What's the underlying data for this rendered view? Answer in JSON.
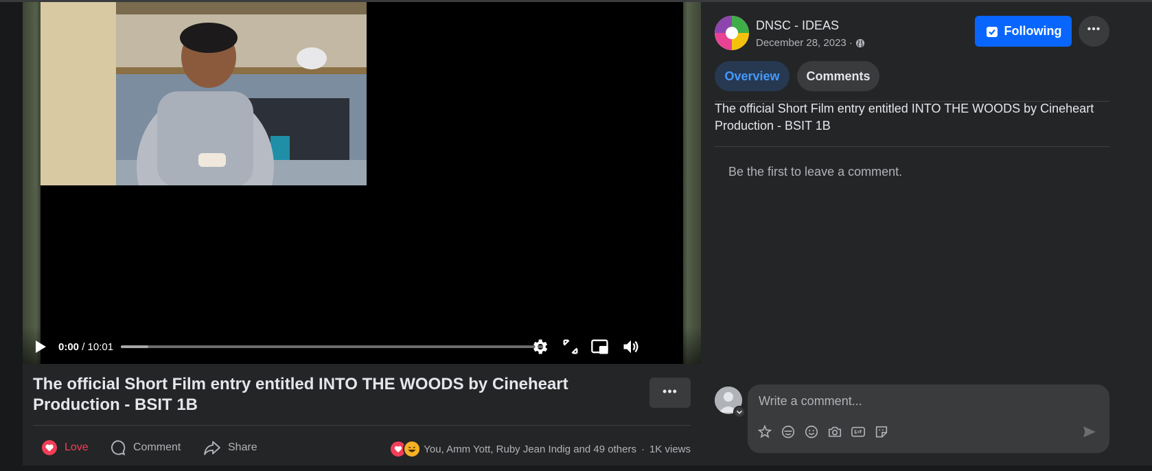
{
  "video": {
    "time_current": "0:00",
    "time_separator": " / ",
    "time_total": "10:01",
    "progress_fraction": 0.065,
    "icons": [
      "play-icon",
      "settings-icon",
      "fullscreen-icon",
      "picture-in-picture-icon",
      "volume-icon"
    ]
  },
  "post": {
    "title": "The official Short Film entry entitled INTO THE WOODS by Cineheart Production - BSIT 1B",
    "more_label": "•••",
    "actions": {
      "love": "Love",
      "comment": "Comment",
      "share": "Share"
    },
    "reactions_text": "You, Amm Yott, Ruby Jean Indig and 49 others",
    "separator": "·",
    "views": "1K views"
  },
  "sidebar": {
    "page_name": "DNSC - IDEAS",
    "date": "December 28, 2023 ·",
    "following_label": "Following",
    "dots_label": "•••",
    "tabs": {
      "overview": "Overview",
      "comments": "Comments"
    },
    "description": "The official Short Film entry entitled INTO THE WOODS by Cineheart Production - BSIT 1B",
    "empty_comments": "Be the first to leave a comment.",
    "comment_placeholder": "Write a comment..."
  },
  "colors": {
    "background": "#18191a",
    "panel": "#242526",
    "accent": "#0866ff",
    "love": "#f33e58",
    "tab_active_bg": "#263951",
    "tab_active_text": "#4599ff"
  }
}
